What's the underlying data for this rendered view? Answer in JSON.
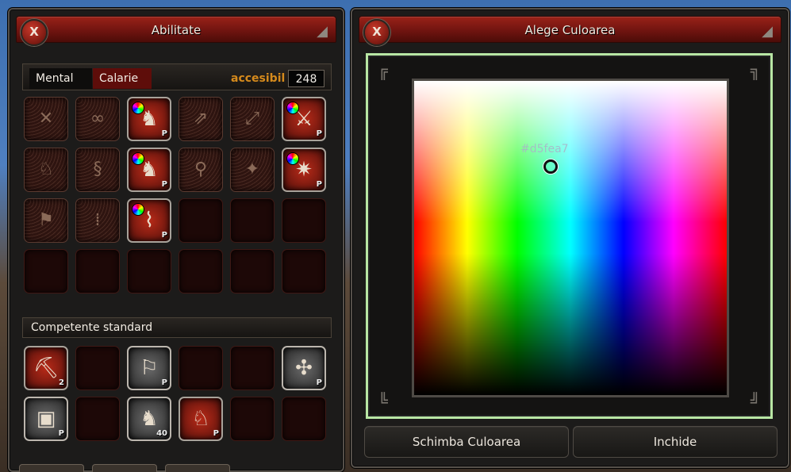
{
  "skills_window": {
    "title": "Abilitate",
    "close_label": "X",
    "tabs": [
      "Mental",
      "Calarie"
    ],
    "active_tab": "Calarie",
    "available_label": "accesibil",
    "available_value": "248",
    "section_label": "Competente standard",
    "skills": [
      {
        "state": "locked",
        "icon": "crossed-blades-icon"
      },
      {
        "state": "locked",
        "icon": "swirl-icon"
      },
      {
        "state": "learned",
        "icon": "mounted-charge-icon",
        "orb": true,
        "level": "P"
      },
      {
        "state": "locked",
        "icon": "arrow-up-icon"
      },
      {
        "state": "locked",
        "icon": "arrow-diagonal-icon"
      },
      {
        "state": "learned",
        "icon": "lance-strike-icon",
        "orb": true,
        "level": "P"
      },
      {
        "state": "locked",
        "icon": "horse-stomp-icon"
      },
      {
        "state": "locked",
        "icon": "spiral-icon"
      },
      {
        "state": "learned",
        "icon": "horse-spin-icon",
        "orb": true,
        "level": "P"
      },
      {
        "state": "locked",
        "icon": "rider-icon"
      },
      {
        "state": "locked",
        "icon": "shatter-icon"
      },
      {
        "state": "learned",
        "icon": "burst-icon",
        "orb": true,
        "level": "P"
      },
      {
        "state": "locked",
        "icon": "banner-icon"
      },
      {
        "state": "locked",
        "icon": "rain-icon"
      },
      {
        "state": "learned",
        "icon": "tornado-icon",
        "orb": true,
        "level": "P"
      },
      {
        "state": "empty"
      },
      {
        "state": "empty"
      },
      {
        "state": "empty"
      },
      {
        "state": "empty"
      },
      {
        "state": "empty"
      },
      {
        "state": "empty"
      },
      {
        "state": "empty"
      },
      {
        "state": "empty"
      },
      {
        "state": "empty"
      }
    ],
    "standard": [
      {
        "state": "learned",
        "icon": "mining-icon",
        "level": "2"
      },
      {
        "state": "empty"
      },
      {
        "state": "learned-grey",
        "icon": "flag-icon",
        "level": "P"
      },
      {
        "state": "empty"
      },
      {
        "state": "empty"
      },
      {
        "state": "learned-grey",
        "icon": "knot-icon",
        "level": "P"
      },
      {
        "state": "learned-grey",
        "icon": "book-icon",
        "level": "P"
      },
      {
        "state": "empty"
      },
      {
        "state": "learned-grey",
        "icon": "horse-icon",
        "level": "40"
      },
      {
        "state": "learned",
        "icon": "horse-head-icon",
        "level": "P"
      },
      {
        "state": "empty"
      },
      {
        "state": "empty"
      }
    ]
  },
  "color_window": {
    "title": "Alege Culoarea",
    "close_label": "X",
    "hex_value": "#d5fea7",
    "change_button": "Schimba Culoarea",
    "close_button": "Inchide",
    "frame_color": "#b8e6a4"
  }
}
